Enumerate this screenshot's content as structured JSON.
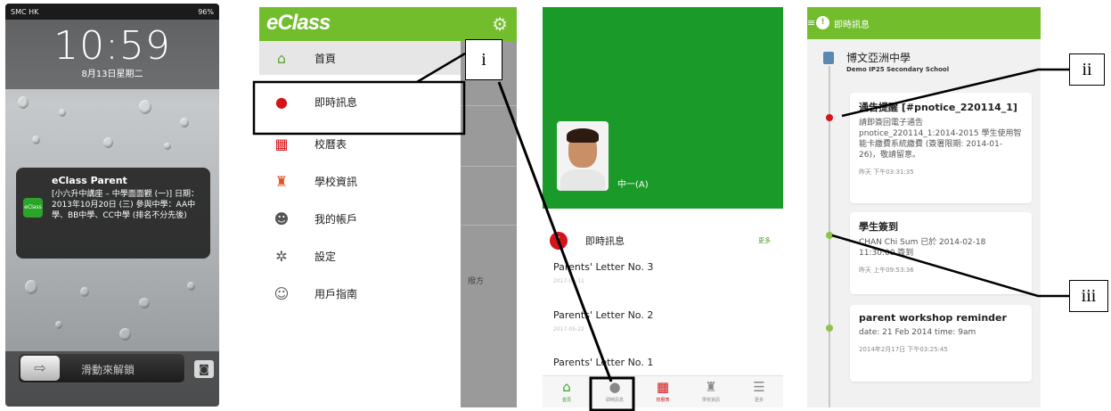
{
  "lock_screen": {
    "carrier": "SMC HK",
    "battery": "96%",
    "time": "10:59",
    "date": "8月13日星期二",
    "notification": {
      "app": "eClass Parent",
      "icon_text": "eClass",
      "body": "[小六升中講座 – 中學面面觀 (一)] 日期：2013年10月20日 (三) 參與中學：AA中學、BB中學、CC中學 (排名不分先後)"
    },
    "slide_label": "滑動來解鎖",
    "arrow_glyph": "⇨",
    "camera_glyph": "◙"
  },
  "menu_screen": {
    "logo": "eClass",
    "gear_glyph": "⚙",
    "items": [
      {
        "label": "首頁",
        "icon": "home-icon",
        "glyph": "⌂"
      },
      {
        "label": "即時訊息",
        "icon": "message-icon",
        "glyph": "●"
      },
      {
        "label": "校曆表",
        "icon": "calendar-icon",
        "glyph": "▦"
      },
      {
        "label": "學校資訊",
        "icon": "school-info-icon",
        "glyph": "♜"
      },
      {
        "label": "我的帳戶",
        "icon": "account-icon",
        "glyph": "☻"
      },
      {
        "label": "設定",
        "icon": "settings-icon",
        "glyph": "✲"
      },
      {
        "label": "用戶指南",
        "icon": "guide-icon",
        "glyph": "☺"
      }
    ],
    "background_text": "撥方"
  },
  "home_screen": {
    "class_name": "中一(A)",
    "section_title": "即時訊息",
    "section_icon_glyph": "!",
    "more_label": "更多",
    "letters": [
      {
        "title": "Parents' Letter No. 3",
        "date": "2017-05-11"
      },
      {
        "title": "Parents' Letter No. 2",
        "date": "2017-05-22"
      },
      {
        "title": "Parents' Letter No. 1",
        "date": ""
      }
    ],
    "tabs": [
      {
        "label": "首頁",
        "icon": "home-icon",
        "glyph": "⌂",
        "color": "#3aa02a"
      },
      {
        "label": "即時訊息",
        "icon": "message-icon",
        "glyph": "●",
        "color": "#888888"
      },
      {
        "label": "校曆表",
        "icon": "calendar-icon",
        "glyph": "▦",
        "color": "#d2141b"
      },
      {
        "label": "學校資訊",
        "icon": "school-info-icon",
        "glyph": "♜",
        "color": "#8a8a8a"
      },
      {
        "label": "更多",
        "icon": "more-icon",
        "glyph": "☰",
        "color": "#888888"
      }
    ]
  },
  "timeline_screen": {
    "title": "即時訊息",
    "title_icon_glyph": "!",
    "school_name": "博文亞洲中學",
    "school_name_en": "Demo IP25 Secondary School",
    "cards": [
      {
        "title": "通告提醒 [#pnotice_220114_1]",
        "body": "請即簽回電子通告 pnotice_220114_1:2014-2015 學生使用智能卡繳費系統繳費 (簽署限期: 2014-01-26)，敬請留意。",
        "time": "昨天 下午03:31:35",
        "dot_color": "#d2141b"
      },
      {
        "title": "學生簽到",
        "body": "CHAN Chi Sum 已於 2014-02-18 11:30:00 簽到",
        "time": "昨天 上午09:53:36",
        "dot_color": "#8cc34a"
      },
      {
        "title": "parent workshop reminder",
        "body": "date: 21 Feb 2014 time: 9am",
        "time": "2014年2月17日 下午03:25:45",
        "dot_color": "#8cc34a"
      }
    ]
  },
  "callouts": {
    "i": "i",
    "ii": "ii",
    "iii": "iii"
  }
}
